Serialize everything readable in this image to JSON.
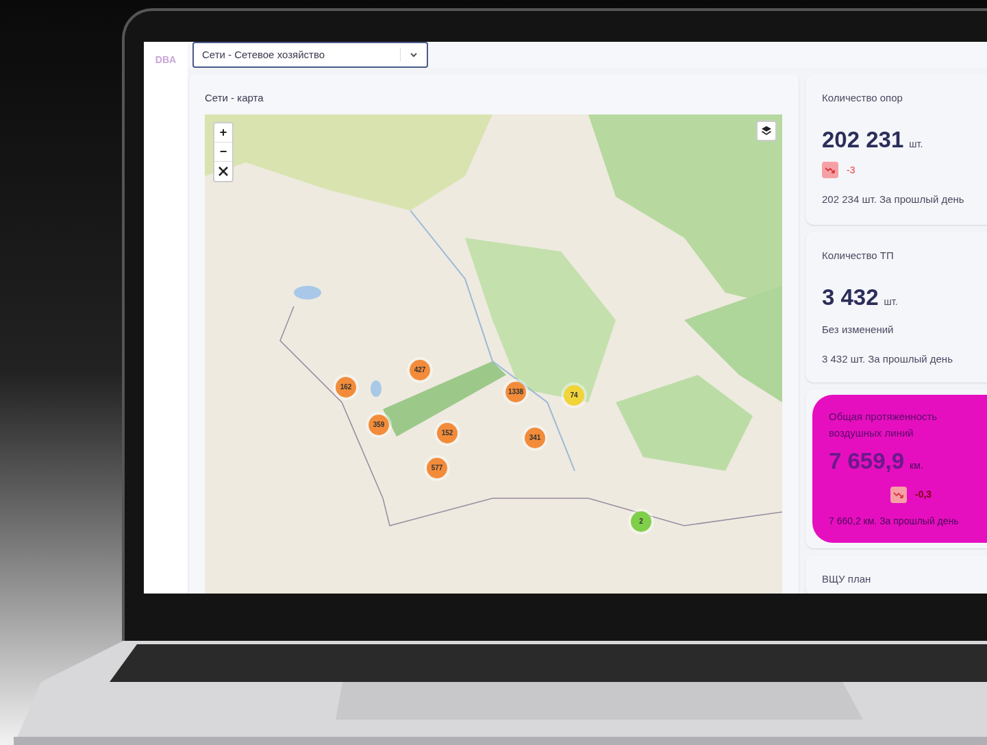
{
  "logo": "DBA",
  "selector": {
    "value": "Сети - Сетевое хозяйство"
  },
  "map_card": {
    "title": "Сети - карта",
    "zoom_controls": [
      "+",
      "−"
    ],
    "clusters": [
      {
        "count": "162",
        "color": "#f28c3a"
      },
      {
        "count": "427",
        "color": "#f28c3a"
      },
      {
        "count": "359",
        "color": "#f28c3a"
      },
      {
        "count": "152",
        "color": "#f28c3a"
      },
      {
        "count": "577",
        "color": "#f28c3a"
      },
      {
        "count": "1338",
        "color": "#f28c3a"
      },
      {
        "count": "341",
        "color": "#f28c3a"
      },
      {
        "count": "74",
        "color": "#f0d43a"
      },
      {
        "count": "2",
        "color": "#7fcf4a"
      }
    ]
  },
  "stats": [
    {
      "kind": "plain",
      "title": "Количество опор",
      "value": "202 231",
      "unit": "шт.",
      "falling": true,
      "delta": "-3",
      "previous": "202 234 шт. За прошлый день"
    },
    {
      "kind": "plain",
      "title": "Количество ТП",
      "value": "3 432",
      "unit": "шт.",
      "falling": false,
      "delta": "Без изменений",
      "previous": "3 432 шт. За прошлый день"
    },
    {
      "kind": "highlight",
      "title": "Общая протяженность воздушных линий",
      "value": "7 659,9",
      "unit": "км.",
      "falling": true,
      "delta": "-0,3",
      "previous": "7 660,2 км. За прошлый день"
    },
    {
      "kind": "cut",
      "title": "ВЩУ план"
    }
  ]
}
